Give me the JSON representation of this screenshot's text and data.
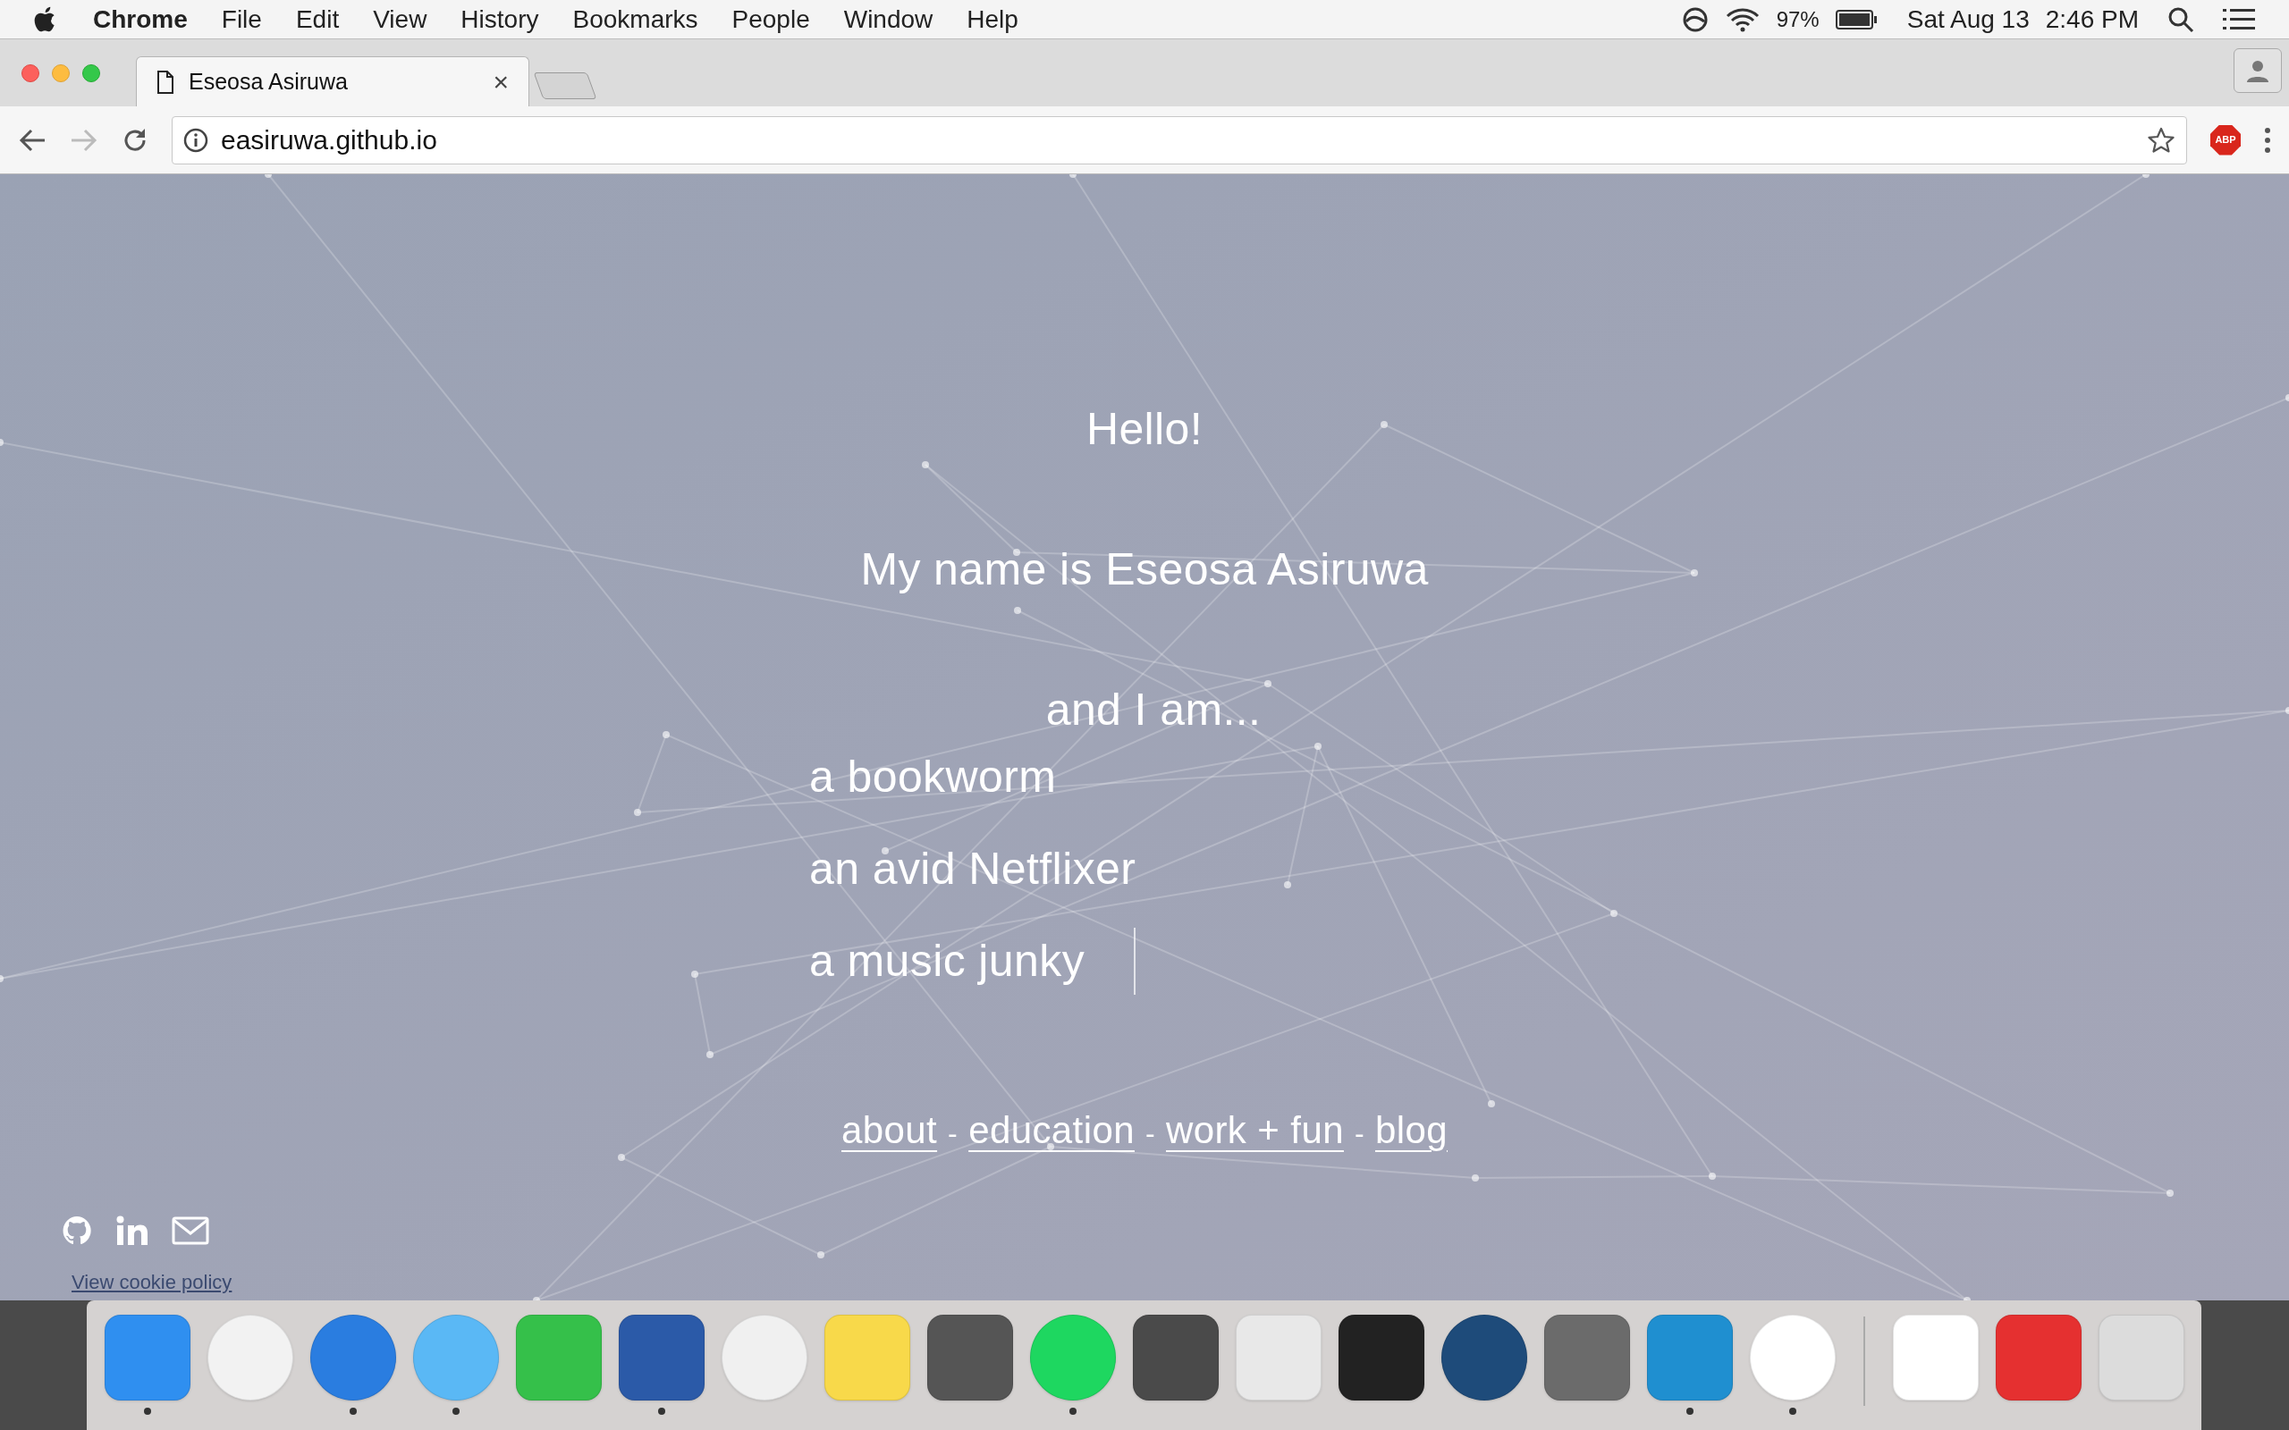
{
  "menu_bar": {
    "app": "Chrome",
    "menus": [
      "File",
      "Edit",
      "View",
      "History",
      "Bookmarks",
      "People",
      "Window",
      "Help"
    ],
    "battery": "97%",
    "date": "Sat Aug 13",
    "time": "2:46 PM"
  },
  "tabs": [
    {
      "title": "Eseosa Asiruwa",
      "selected": true,
      "close": "×"
    }
  ],
  "address_bar": {
    "url": "easiruwa.github.io",
    "extension": "ABP"
  },
  "page": {
    "greeting": "Hello!",
    "intro": "My name is Eseosa Asiruwa",
    "lead": "and I am...",
    "traits": [
      "a bookworm",
      "an avid Netflixer",
      "a music junky"
    ],
    "links": [
      {
        "label": "about"
      },
      {
        "label": "education"
      },
      {
        "label": "work + fun"
      },
      {
        "label": "blog"
      }
    ],
    "separator": "-",
    "cookie_link": "View cookie policy"
  },
  "dock": [
    {
      "kind": "app",
      "running": true
    },
    {
      "kind": "app",
      "running": false
    },
    {
      "kind": "app",
      "running": true
    },
    {
      "kind": "app",
      "running": true
    },
    {
      "kind": "app",
      "running": false
    },
    {
      "kind": "app",
      "running": true
    },
    {
      "kind": "app",
      "running": false
    },
    {
      "kind": "app",
      "running": false
    },
    {
      "kind": "app",
      "running": false
    },
    {
      "kind": "app",
      "running": true
    },
    {
      "kind": "app",
      "running": false
    },
    {
      "kind": "app",
      "running": false
    },
    {
      "kind": "app",
      "running": false
    },
    {
      "kind": "app",
      "running": false
    },
    {
      "kind": "app",
      "running": false
    },
    {
      "kind": "app",
      "running": true
    },
    {
      "kind": "app",
      "running": true
    },
    {
      "kind": "divider"
    },
    {
      "kind": "app",
      "running": false
    },
    {
      "kind": "app",
      "running": false
    },
    {
      "kind": "app",
      "running": false
    }
  ]
}
